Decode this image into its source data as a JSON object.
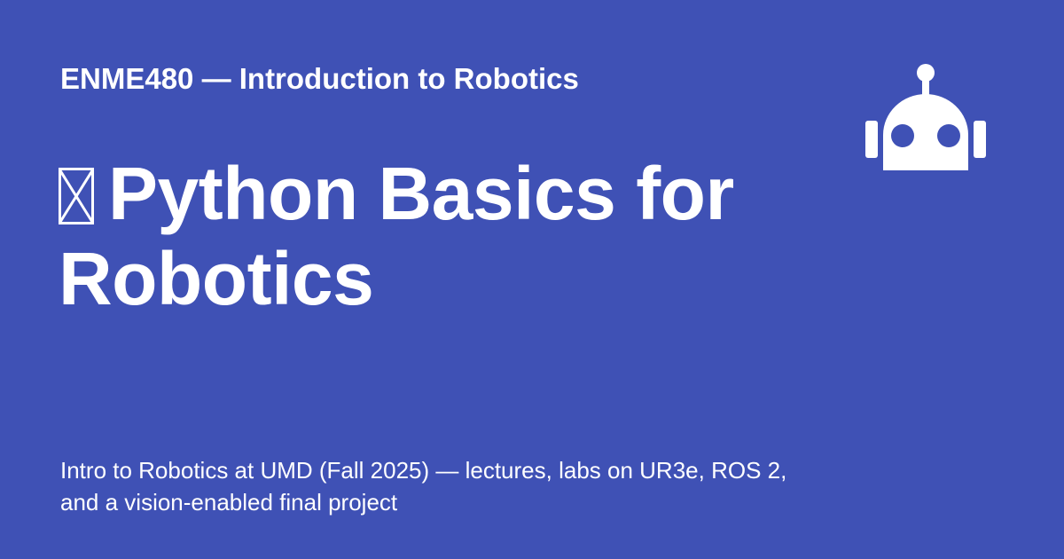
{
  "card": {
    "site_name": "ENME480 — Introduction to Robotics",
    "title": "Python Basics for Robotics",
    "description": "Intro to Robotics at UMD (Fall 2025) — lectures, labs on UR3e, ROS 2, and a vision-enabled final project",
    "logo_icon": "robot-head-icon",
    "title_glyph_icon": "missing-glyph-icon"
  },
  "colors": {
    "background": "#3f51b5",
    "foreground": "#ffffff"
  }
}
